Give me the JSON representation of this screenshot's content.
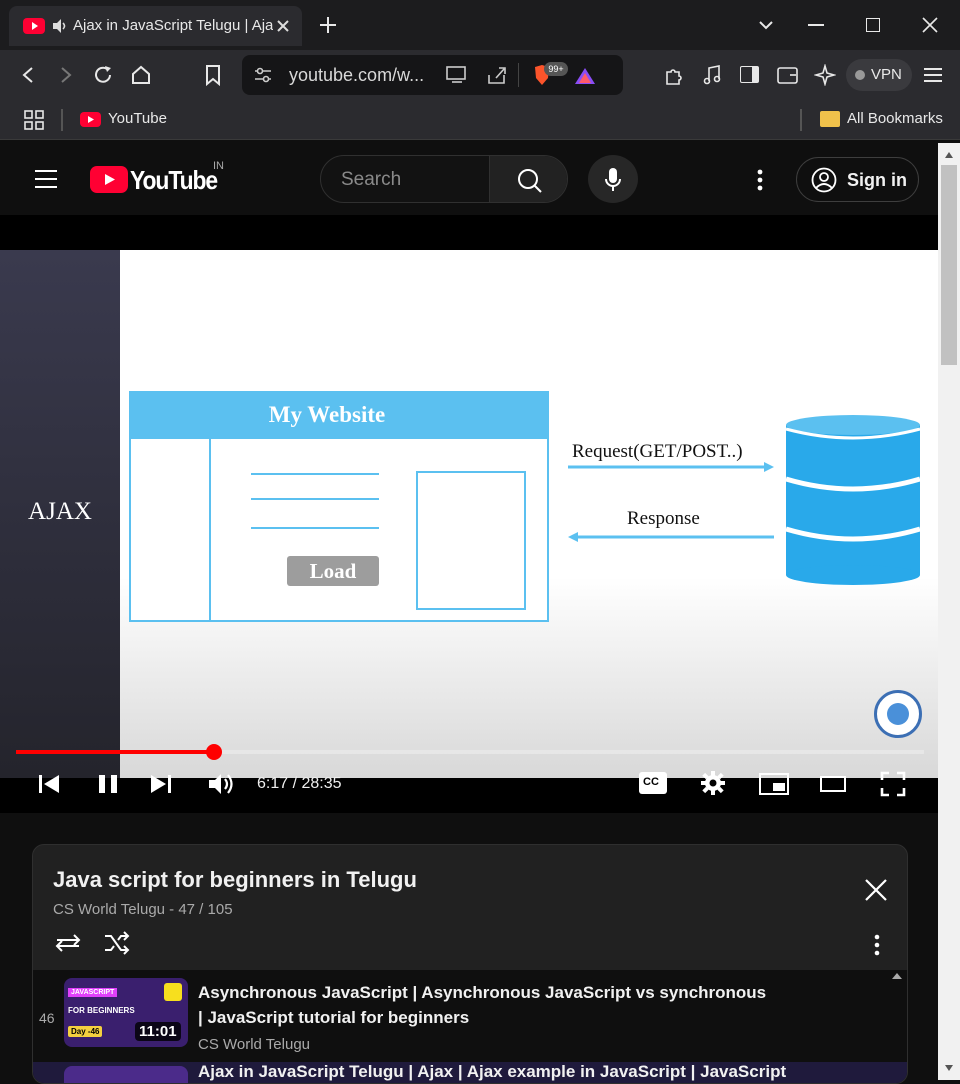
{
  "browser": {
    "tab_title": "Ajax in JavaScript Telugu | Ajax example in JavaScript",
    "url": "youtube.com/w...",
    "brave_badge": "99+",
    "vpn_label": "VPN",
    "bookmarks": {
      "youtube": "YouTube",
      "all": "All Bookmarks"
    }
  },
  "youtube": {
    "logo_text": "YouTube",
    "country": "IN",
    "search_placeholder": "Search",
    "sign_in": "Sign in"
  },
  "video": {
    "sidebar_title": "AJAX",
    "site_title": "My Website",
    "load_button": "Load",
    "request_label": "Request(GET/POST..)",
    "response_label": "Response",
    "time": "6:17 / 28:35",
    "progress": 0.2179
  },
  "playlist": {
    "title": "Java script for beginners in Telugu",
    "subtitle": "CS World Telugu - 47 / 105",
    "items": [
      {
        "index": "46",
        "title": "Asynchronous JavaScript | Asynchronous JavaScript vs synchronous | JavaScript tutorial for beginners",
        "channel": "CS World Telugu",
        "duration": "11:01",
        "thumb_top": "JAVASCRIPT",
        "thumb_mid": "FOR BEGINNERS",
        "thumb_day": "Day -46"
      },
      {
        "title": "Ajax in JavaScript Telugu | Ajax | Ajax example in JavaScript | JavaScript"
      }
    ]
  }
}
